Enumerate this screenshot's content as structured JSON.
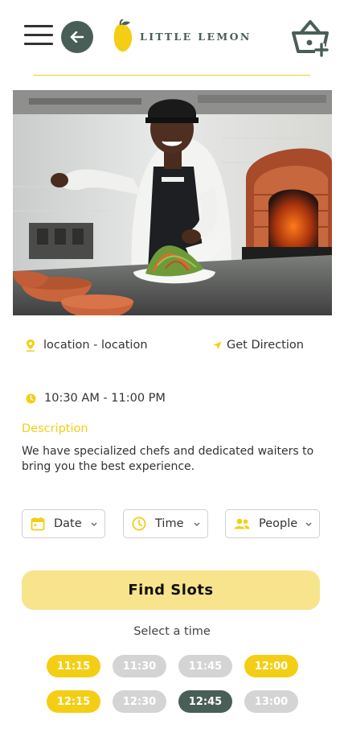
{
  "brand": {
    "name": "LITTLE LEMON"
  },
  "colors": {
    "primary_green": "#495e57",
    "primary_yellow": "#f4ce14",
    "button_light_yellow": "#f8e48c",
    "unavailable_gray": "#d4d4d4"
  },
  "header": {
    "menu_icon": "hamburger-icon",
    "back_icon": "arrow-left-icon",
    "cart_icon": "basket-add-icon"
  },
  "location": {
    "icon": "map-pin-icon",
    "text": "location - location"
  },
  "direction": {
    "icon": "navigation-arrow-icon",
    "label": "Get Direction"
  },
  "hours": {
    "icon": "clock-icon",
    "text": "10:30 AM - 11:00 PM"
  },
  "description": {
    "title": "Description",
    "text": "We have specialized chefs and dedicated waiters to bring you the best experience."
  },
  "filters": {
    "date": {
      "icon": "calendar-icon",
      "label": "Date"
    },
    "time": {
      "icon": "clock-icon",
      "label": "Time"
    },
    "people": {
      "icon": "people-icon",
      "label": "People"
    }
  },
  "find_button": "Find Slots",
  "select_time_label": "Select a time",
  "slots": [
    {
      "time": "11:15",
      "state": "available"
    },
    {
      "time": "11:30",
      "state": "unavailable"
    },
    {
      "time": "11:45",
      "state": "unavailable"
    },
    {
      "time": "12:00",
      "state": "available"
    },
    {
      "time": "12:15",
      "state": "available"
    },
    {
      "time": "12:30",
      "state": "unavailable"
    },
    {
      "time": "12:45",
      "state": "selected"
    },
    {
      "time": "13:00",
      "state": "unavailable"
    }
  ]
}
